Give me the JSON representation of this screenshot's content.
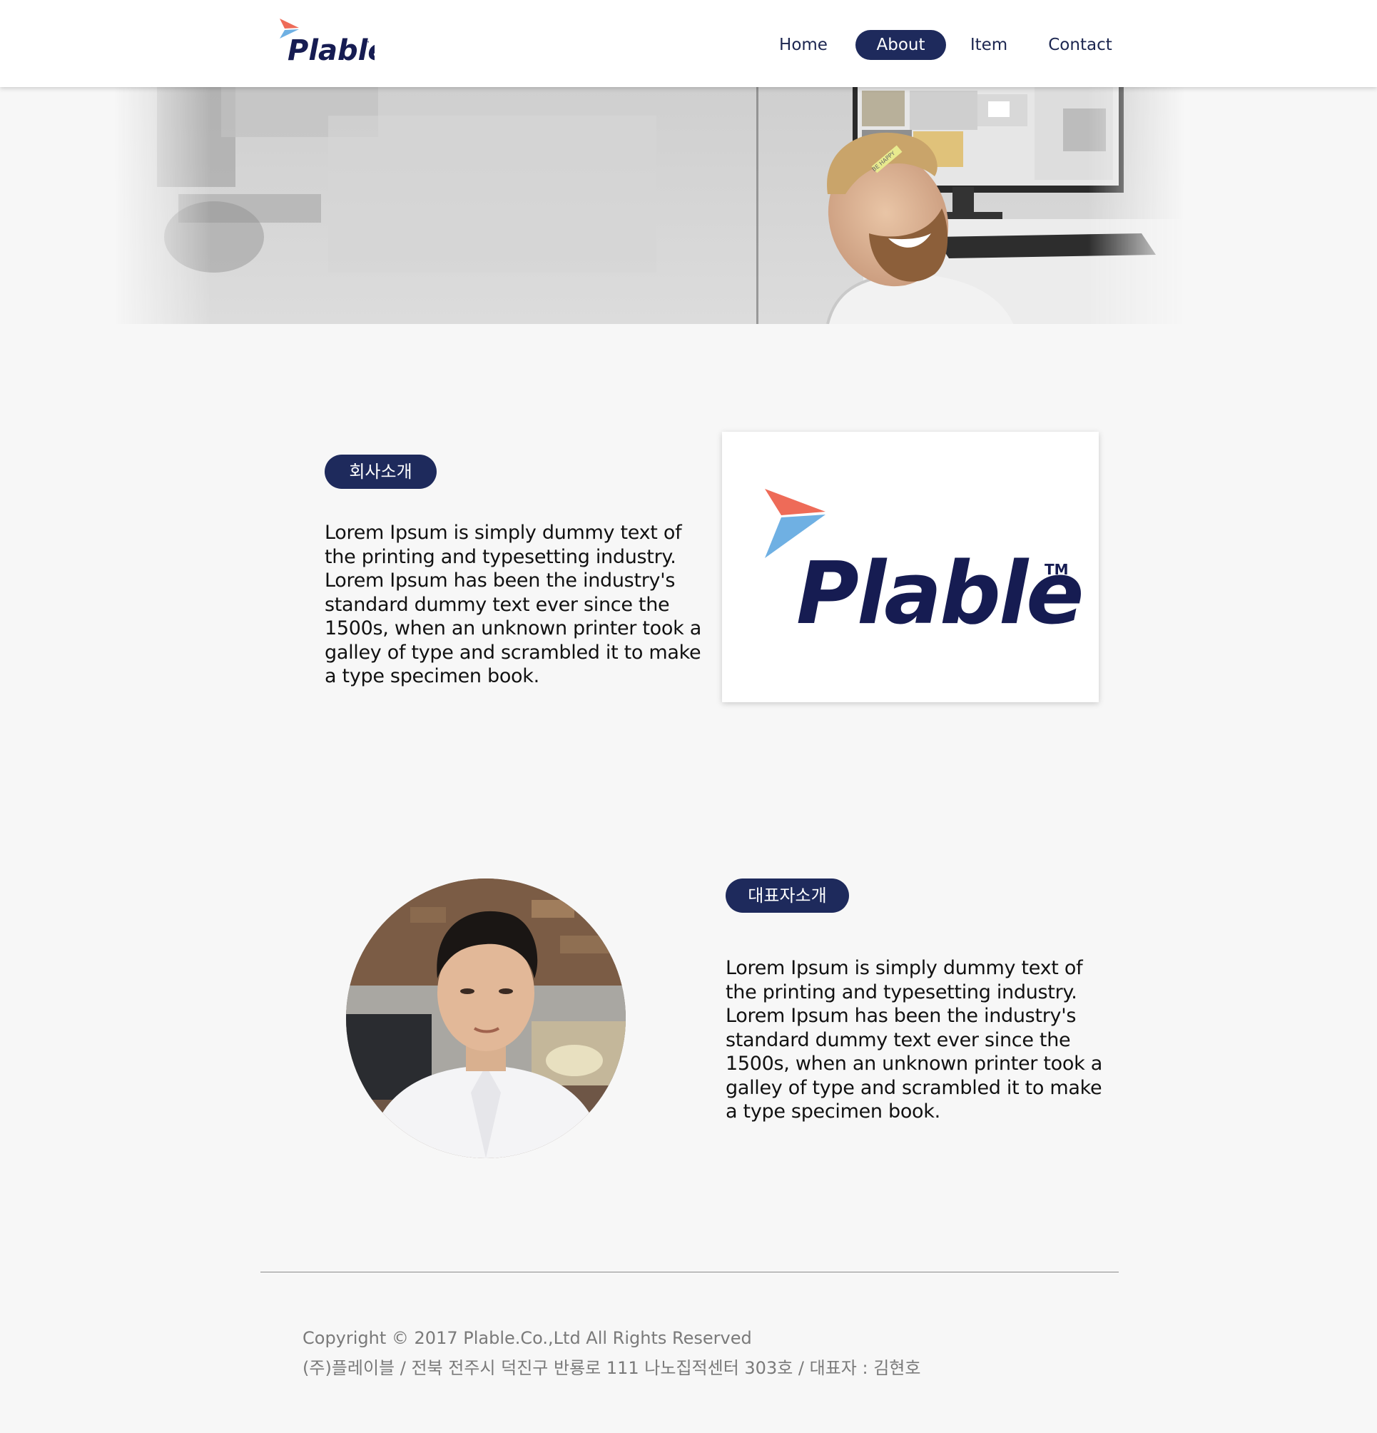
{
  "header": {
    "logo_text": "Plable",
    "logo_tm": "™",
    "nav": [
      {
        "label": "Home",
        "active": false
      },
      {
        "label": "About",
        "active": true
      },
      {
        "label": "Item",
        "active": false
      },
      {
        "label": "Contact",
        "active": false
      }
    ]
  },
  "hero": {
    "sticker_text": "BE HAPPY"
  },
  "company_section": {
    "badge": "회사소개",
    "body": "Lorem Ipsum is simply dummy text of the printing and typesetting industry. Lorem Ipsum has been the industry's standard dummy text ever since the 1500s, when an unknown printer took a galley of type and scrambled it to make a type specimen book.",
    "logo_text": "Plable",
    "logo_tm": "TM"
  },
  "ceo_section": {
    "badge": "대표자소개",
    "body": "Lorem Ipsum is simply dummy text of the printing and typesetting industry. Lorem Ipsum has been the industry's standard dummy text ever since the 1500s, when an unknown printer took a galley of type and scrambled it to make a type specimen book."
  },
  "footer": {
    "copyright": "Copyright © 2017 Plable.Co.,Ltd All Rights Reserved",
    "address": "(주)플레이블 / 전북 전주시 덕진구 반룡로 111 나노집적센터 303호 / 대표자 : 김현호"
  },
  "colors": {
    "navy": "#1e2a5c",
    "logo_navy": "#161c52",
    "logo_coral": "#ee6b58",
    "logo_blue": "#6fb0e3",
    "background": "#f7f7f7"
  }
}
